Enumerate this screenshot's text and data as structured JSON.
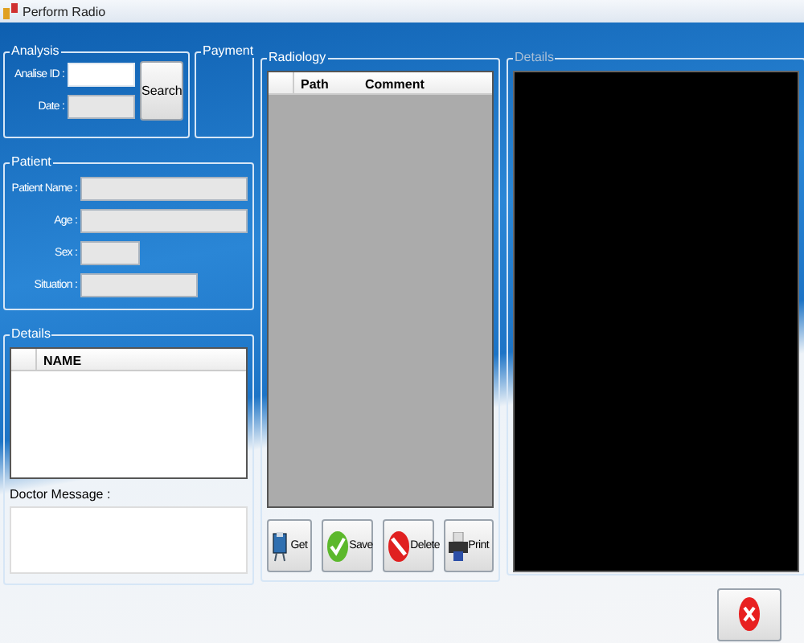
{
  "window": {
    "title": "Perform Radio"
  },
  "analysis": {
    "title": "Analysis",
    "fields": [
      {
        "label": "Analise ID :",
        "disabled": false
      },
      {
        "label": "Date :",
        "disabled": true
      }
    ],
    "search_button": "Search"
  },
  "payment": {
    "title": "Payment"
  },
  "patient": {
    "title": "Patient",
    "fields": [
      {
        "label": "Patient Name :",
        "disabled": true
      },
      {
        "label": "Age :",
        "disabled": true
      },
      {
        "label": "Sex :",
        "disabled": true
      },
      {
        "label": "Situation :",
        "disabled": true
      }
    ]
  },
  "details": {
    "title": "Details",
    "columns": [
      "NAME"
    ],
    "message_label": "Doctor Message :"
  },
  "radiology": {
    "title": "Radiology",
    "columns": [
      "Path",
      "Comment"
    ],
    "buttons": [
      {
        "label": "Get",
        "kind": "get"
      },
      {
        "label": "Save",
        "kind": "save"
      },
      {
        "label": "Delete",
        "kind": "delete"
      },
      {
        "label": "Print",
        "kind": "print"
      }
    ]
  },
  "viewer": {
    "title": "Details",
    "disabled": true
  }
}
